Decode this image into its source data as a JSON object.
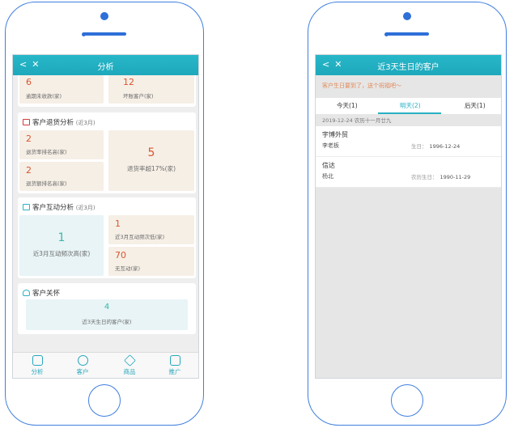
{
  "left_phone": {
    "title": "分析",
    "top_metrics": [
      {
        "value": "6",
        "label": "逾期未收款(家)"
      },
      {
        "value": "12",
        "label": "坏账客户(家)"
      }
    ],
    "return_analysis": {
      "title": "客户退货分析",
      "period": "(近3月)",
      "items": [
        {
          "value": "2",
          "label": "退货率排名高(家)"
        },
        {
          "value": "2",
          "label": "退货额排名高(家)"
        }
      ],
      "big": {
        "value": "5",
        "label": "退货率超17%(家)"
      }
    },
    "interaction_analysis": {
      "title": "客户互动分析",
      "period": "(近3月)",
      "big": {
        "value": "1",
        "label": "近3月互动频次高(家)"
      },
      "items": [
        {
          "value": "1",
          "label": "近3月互动频次低(家)"
        },
        {
          "value": "70",
          "label": "无互动(家)"
        }
      ]
    },
    "care": {
      "title": "客户关怀",
      "value": "4",
      "label": "近3天生日的客户(家)"
    },
    "tabs": [
      {
        "label": "分析",
        "icon": "chart-icon"
      },
      {
        "label": "客户",
        "icon": "customer-icon"
      },
      {
        "label": "商品",
        "icon": "goods-icon"
      },
      {
        "label": "推广",
        "icon": "share-icon"
      }
    ]
  },
  "right_phone": {
    "title": "近3天生日的客户",
    "notice": "客户生日要到了，送个祝福吧～",
    "day_tabs": [
      {
        "label": "今天(1)"
      },
      {
        "label": "明天(2)"
      },
      {
        "label": "后天(1)"
      }
    ],
    "date_line": "2019-12-24  农历十一月廿九",
    "customers": [
      {
        "company": "宇博外贸",
        "contact": "李老板",
        "birthday_label": "生日：",
        "birthday": "1996-12-24"
      },
      {
        "company": "信达",
        "contact": "杨北",
        "birthday_label": "农历生日：",
        "birthday": "1990-11-29"
      }
    ]
  }
}
